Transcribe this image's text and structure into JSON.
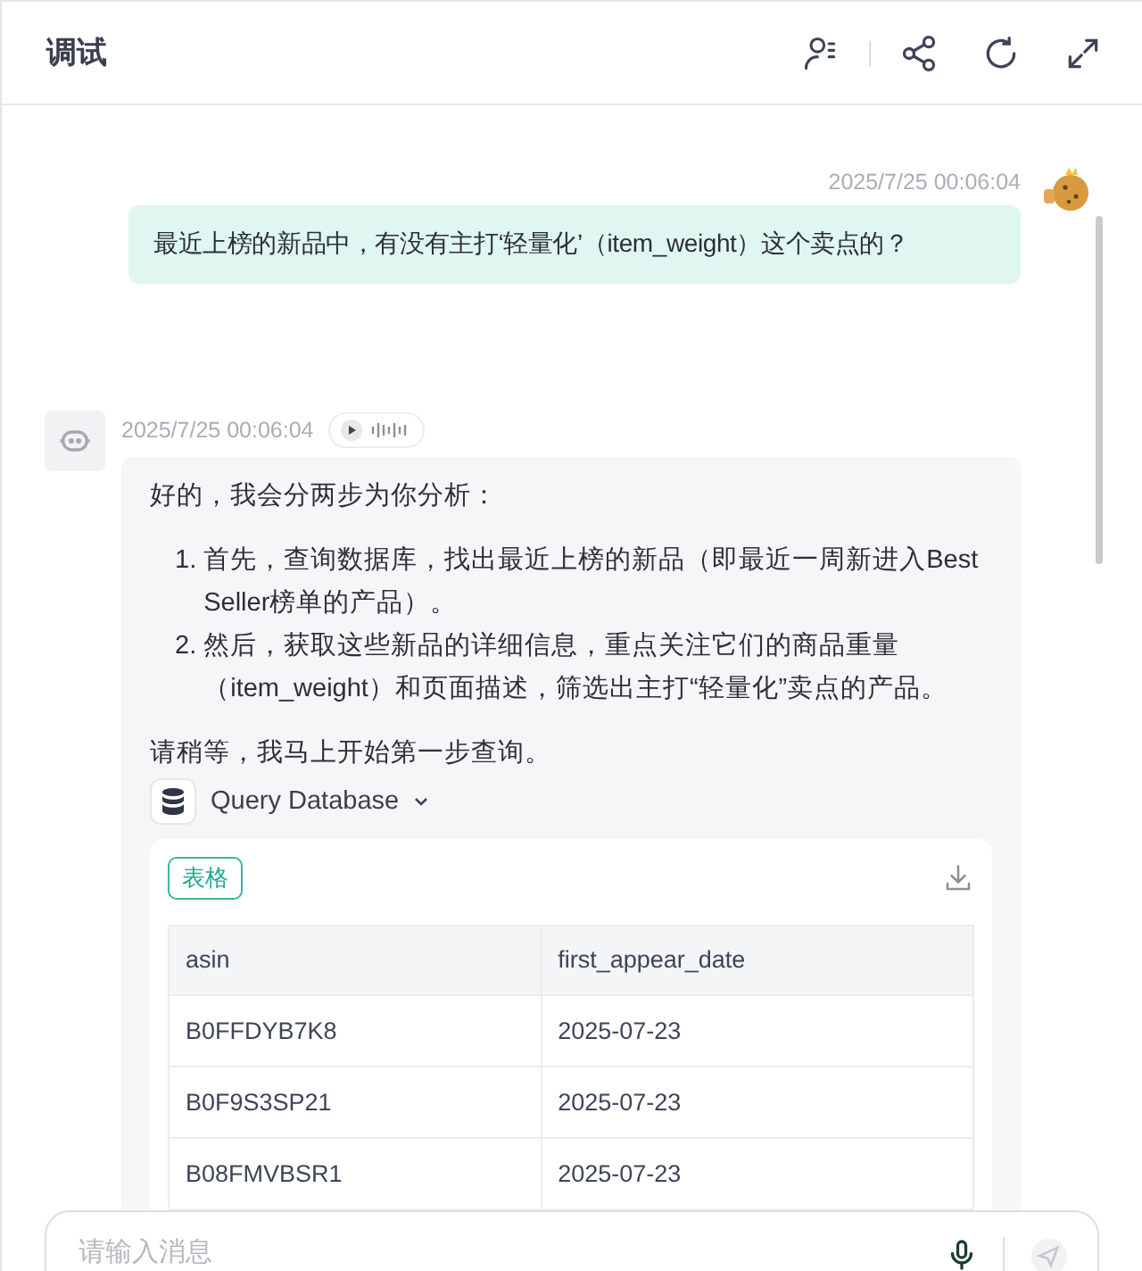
{
  "header": {
    "title": "调试"
  },
  "user_message": {
    "time": "2025/7/25 00:06:04",
    "text": "最近上榜的新品中，有没有主打‘轻量化’（item_weight）这个卖点的？"
  },
  "bot_message": {
    "time": "2025/7/25 00:06:04",
    "intro": "好的，我会分两步为你分析：",
    "steps": [
      {
        "number": "1.",
        "text": "首先，查询数据库，找出最近上榜的新品（即最近一周新进入Best Seller榜单的产品）。"
      },
      {
        "number": "2.",
        "text": "然后，获取这些新品的详细信息，重点关注它们的商品重量（item_weight）和页面描述，筛选出主打“轻量化”卖点的产品。"
      }
    ],
    "outro": "请稍等，我马上开始第一步查询。",
    "tool": {
      "name": "Query Database",
      "expanded": false
    },
    "result": {
      "tag": "表格",
      "table": {
        "columns": [
          "asin",
          "first_appear_date"
        ],
        "rows": [
          [
            "B0FFDYB7K8",
            "2025-07-23"
          ],
          [
            "B0F9S3SP21",
            "2025-07-23"
          ],
          [
            "B08FMVBSR1",
            "2025-07-23"
          ]
        ]
      }
    }
  },
  "composer": {
    "placeholder": "请输入消息"
  }
}
